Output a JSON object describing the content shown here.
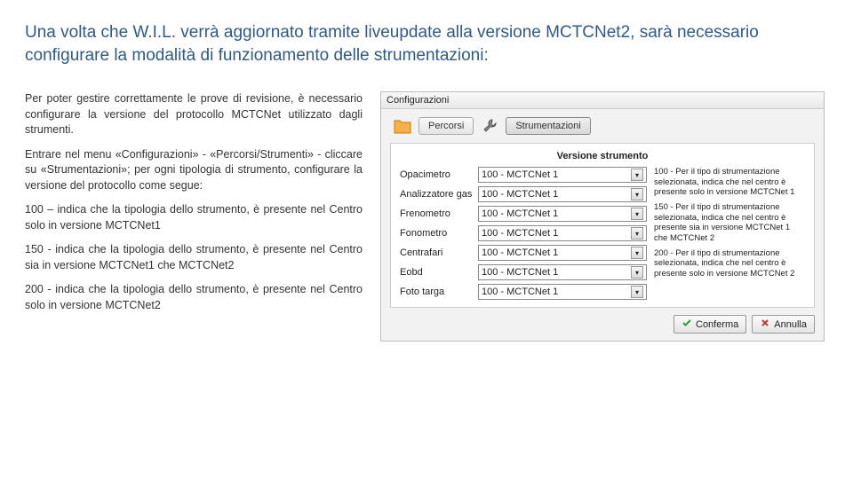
{
  "heading1": "Una volta che W.I.L. verrà aggiornato tramite liveupdate alla versione MCTCNet2, sarà necessario configurare la modalità di funzionamento delle strumentazioni:",
  "leftcol": {
    "p1": "Per poter gestire correttamente le prove di revisione, è necessario configurare la versione del protocollo MCTCNet utilizzato dagli strumenti.",
    "p2": "Entrare nel menu «Configurazioni» - «Percorsi/Strumenti» - cliccare su «Strumentazioni»; per ogni tipologia di strumento, configurare la versione del protocollo come segue:",
    "p3": "100 – indica che la tipologia dello strumento, è presente nel Centro solo in versione MCTCNet1",
    "p4": "150 - indica che la tipologia dello strumento, è presente nel Centro sia in versione MCTCNet1 che MCTCNet2",
    "p5": "200 - indica che la tipologia dello strumento, è presente nel Centro solo in versione MCTCNet2"
  },
  "dialog": {
    "title": "Configurazioni",
    "tab1": "Percorsi",
    "tab2": "Strumentazioni",
    "panel_title": "Versione strumento",
    "rows": [
      {
        "label": "Opacimetro",
        "value": "100 - MCTCNet 1"
      },
      {
        "label": "Analizzatore gas",
        "value": "100 - MCTCNet 1"
      },
      {
        "label": "Frenometro",
        "value": "100 - MCTCNet 1"
      },
      {
        "label": "Fonometro",
        "value": "100 - MCTCNet 1"
      },
      {
        "label": "Centrafari",
        "value": "100 - MCTCNet 1"
      },
      {
        "label": "Eobd",
        "value": "100 - MCTCNet 1"
      },
      {
        "label": "Foto targa",
        "value": "100 - MCTCNet 1"
      }
    ],
    "expl": {
      "e1": "100 - Per il tipo di strumentazione selezionata, indica che nel centro è presente solo in versione MCTCNet 1",
      "e2": "150 - Per il tipo di strumentazione selezionata, indica che nel centro è presente sia in versione MCTCNet 1 che MCTCNet 2",
      "e3": "200 - Per il tipo di strumentazione selezionata, indica che nel centro è presente solo in versione MCTCNet 2"
    },
    "confirm": "Conferma",
    "cancel": "Annulla"
  }
}
